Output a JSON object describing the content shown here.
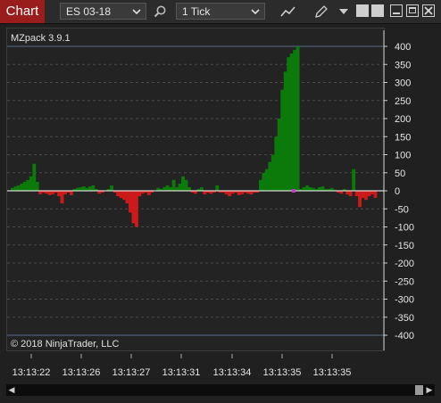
{
  "toolbar": {
    "chart_tab": "Chart",
    "instrument": "ES 03-18",
    "interval": "1 Tick",
    "icons": [
      "chevron-down-icon",
      "search-icon",
      "line-chart-icon",
      "pencil-icon",
      "dropdown-arrow-icon",
      "window-tile-icon",
      "window-tile-icon",
      "minimize-icon",
      "maximize-icon",
      "close-icon"
    ]
  },
  "chart": {
    "indicator_label": "MZpack 3.9.1",
    "copyright": "© 2018 NinjaTrader, LLC",
    "y_ticks": [
      "400",
      "350",
      "300",
      "250",
      "200",
      "150",
      "100",
      "50",
      "0",
      "-50",
      "-100",
      "-150",
      "-200",
      "-250",
      "-300",
      "-350",
      "-400"
    ],
    "x_ticks": [
      "13:13:22",
      "13:13:26",
      "13:13:27",
      "13:13:31",
      "13:13:34",
      "13:13:35",
      "13:13:35"
    ],
    "colors": {
      "positive": "#0b7a0b",
      "negative": "#cc1a1a",
      "zero_line": "#ffffff",
      "marker": "#d030d0",
      "grid": "#4a4a4a",
      "background": "#232323"
    }
  },
  "chart_data": {
    "type": "bar",
    "title": "MZpack 3.9.1",
    "ylim": [
      -400,
      400
    ],
    "x_labels": [
      "13:13:22",
      "13:13:26",
      "13:13:27",
      "13:13:31",
      "13:13:34",
      "13:13:35",
      "13:13:35"
    ],
    "values": [
      8,
      12,
      15,
      20,
      25,
      30,
      40,
      75,
      25,
      -10,
      -5,
      -8,
      -12,
      -10,
      -5,
      -15,
      -35,
      -10,
      -5,
      -12,
      5,
      8,
      10,
      12,
      8,
      12,
      15,
      5,
      -8,
      -5,
      0,
      5,
      15,
      -5,
      -15,
      -20,
      -25,
      -35,
      -60,
      -90,
      -100,
      -15,
      -8,
      -5,
      -12,
      -5,
      0,
      8,
      5,
      10,
      15,
      10,
      30,
      10,
      20,
      40,
      30,
      10,
      -5,
      -8,
      5,
      10,
      -10,
      -5,
      -8,
      -5,
      15,
      -5,
      -5,
      -10,
      -15,
      -8,
      -5,
      -12,
      -10,
      -5,
      -8,
      -10,
      -5,
      -5,
      30,
      50,
      60,
      80,
      100,
      150,
      200,
      280,
      330,
      370,
      380,
      390,
      400,
      5,
      10,
      15,
      10,
      8,
      5,
      10,
      12,
      5,
      5,
      8,
      3,
      -5,
      -8,
      5,
      -10,
      -15,
      60,
      -15,
      -45,
      -20,
      -25,
      -15,
      -10,
      -20
    ]
  },
  "scrollbar": {
    "left": "◀",
    "right": "▶"
  }
}
